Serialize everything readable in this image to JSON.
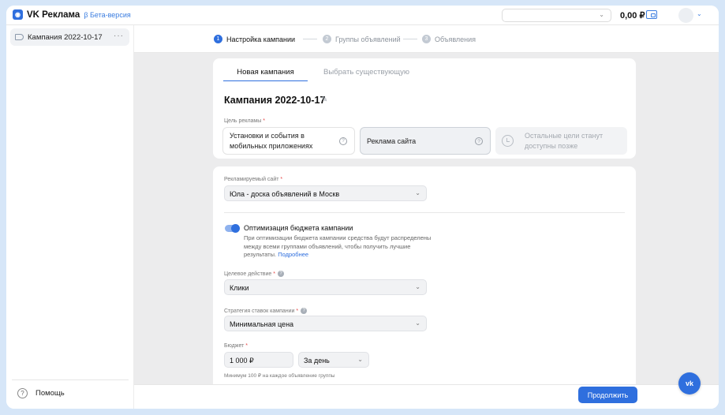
{
  "header": {
    "logo_text": "VK Реклама",
    "beta_label": "β Бета-версия",
    "account_select_value": "",
    "balance": "0,00 ₽"
  },
  "sidebar": {
    "campaign_label": "Кампания 2022-10-17",
    "help_label": "Помощь"
  },
  "steps": [
    {
      "num": "1",
      "label": "Настройка кампании",
      "state": "active"
    },
    {
      "num": "2",
      "label": "Группы объявлений",
      "state": "inactive"
    },
    {
      "num": "3",
      "label": "Объявления",
      "state": "inactive"
    }
  ],
  "tabs": {
    "new": "Новая кампания",
    "existing": "Выбрать существующую"
  },
  "campaign": {
    "title": "Кампания 2022-10-17",
    "goal_label": "Цель рекламы",
    "goals": [
      "Установки и события в мобильных приложениях",
      "Реклама сайта",
      "Остальные цели станут доступны позже"
    ],
    "selected_goal": "Реклама сайта"
  },
  "form": {
    "site_label": "Рекламируемый сайт",
    "site_value": "Юла - доска объявлений в Москв",
    "optimization": {
      "enabled": true,
      "title": "Оптимизация бюджета кампании",
      "description": "При оптимизации бюджета кампании средства будут распределены между всеми группами объявлений, чтобы получить лучшие результаты.",
      "link": "Подробнее"
    },
    "target_action_label": "Целевое действие",
    "target_action_value": "Клики",
    "bid_strategy_label": "Стратегия ставок кампании",
    "bid_strategy_value": "Минимальная цена",
    "budget_label": "Бюджет",
    "budget_value": "1 000 ₽",
    "budget_period": "За день",
    "budget_hint": "Минимум 100 ₽ на каждое объявление группы"
  },
  "footer": {
    "continue_label": "Продолжить"
  },
  "colors": {
    "accent": "#2f6fde",
    "background": "#d6e6f8",
    "content_bg": "#ececed"
  }
}
